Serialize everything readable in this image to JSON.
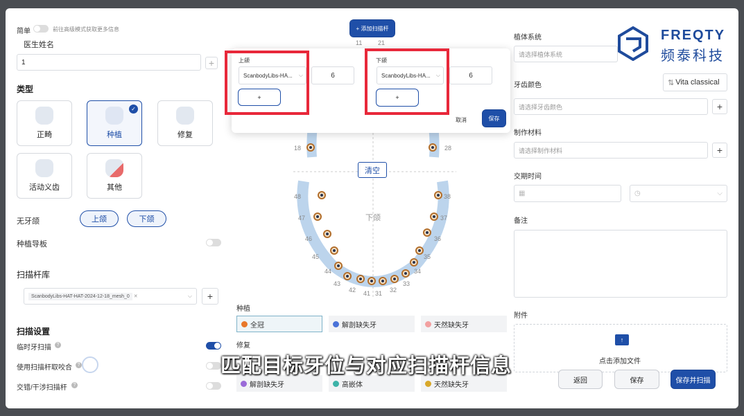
{
  "top_bar": {
    "simple_label": "简单",
    "advanced_hint": "前往高级模式获取更多信息",
    "add_scanbody_button": "+ 添加扫描杆"
  },
  "left": {
    "doctor_name_label": "医生姓名",
    "doctor_name_value": "1",
    "type_title": "类型",
    "types": [
      {
        "label": "正畸"
      },
      {
        "label": "种植"
      },
      {
        "label": "修复"
      },
      {
        "label": "活动义齿"
      },
      {
        "label": "其他"
      }
    ],
    "edentulous_label": "无牙颌",
    "upper_jaw": "上颌",
    "lower_jaw": "下颌",
    "guide_label": "种植导板",
    "scanbody_lib_label": "扫描杆库",
    "scanbody_tag": "ScanbodyLibs-HAT-HAT-2024-12-18_mesh_0",
    "scan_settings_title": "扫描设置",
    "temp_tooth_scan": "临时牙扫描",
    "use_scanbody_bite": "使用扫描杆取咬合",
    "interlace_scanbody": "交错/干涉扫描杆"
  },
  "popup": {
    "upper_title": "上颌",
    "upper_select": "ScanbodyLibs-HA...",
    "upper_qty": "6",
    "lower_title": "下颌",
    "lower_select": "ScanbodyLibs-HA...",
    "lower_qty": "6",
    "add_symbol": "+",
    "cancel": "取消",
    "save": "保存"
  },
  "chart": {
    "top_numbers": [
      "11",
      "21"
    ],
    "upper_left_num": "18",
    "upper_right_num": "28",
    "clear_button": "清空",
    "lower_label": "下颌",
    "lower_numbers": [
      "48",
      "47",
      "46",
      "45",
      "44",
      "43",
      "42",
      "41",
      "31",
      "32",
      "33",
      "34",
      "35",
      "36",
      "37",
      "38"
    ]
  },
  "options": {
    "implant_title": "种植",
    "implant": [
      {
        "label": "全冠",
        "color": "#e8782a"
      },
      {
        "label": "解剖缺失牙",
        "color": "#4a72d8"
      },
      {
        "label": "天然缺失牙",
        "color": "#f2a0a0"
      }
    ],
    "restore_title": "修复",
    "restore": [
      {
        "label": "解剖缺失牙",
        "color": "#9a6ad8"
      },
      {
        "label": "高嵌体",
        "color": "#3db3a8"
      },
      {
        "label": "天然缺失牙",
        "color": "#d8a82a"
      }
    ]
  },
  "right": {
    "implant_system_label": "植体系统",
    "implant_system_placeholder": "请选择植体系统",
    "shade_label": "牙齿颜色",
    "shade_guide": "Vita classical",
    "shade_placeholder": "请选择牙齿颜色",
    "material_label": "制作材料",
    "material_placeholder": "请选择制作材料",
    "delivery_label": "交期时间",
    "note_label": "备注",
    "attachment_label": "附件",
    "attachment_hint": "点击添加文件",
    "back": "返回",
    "save": "保存",
    "save_and_scan": "保存并扫描"
  },
  "logo": {
    "brand_en": "FREQTY",
    "brand_cn": "频泰科技"
  },
  "subtitle": "匹配目标牙位与对应扫描杆信息"
}
